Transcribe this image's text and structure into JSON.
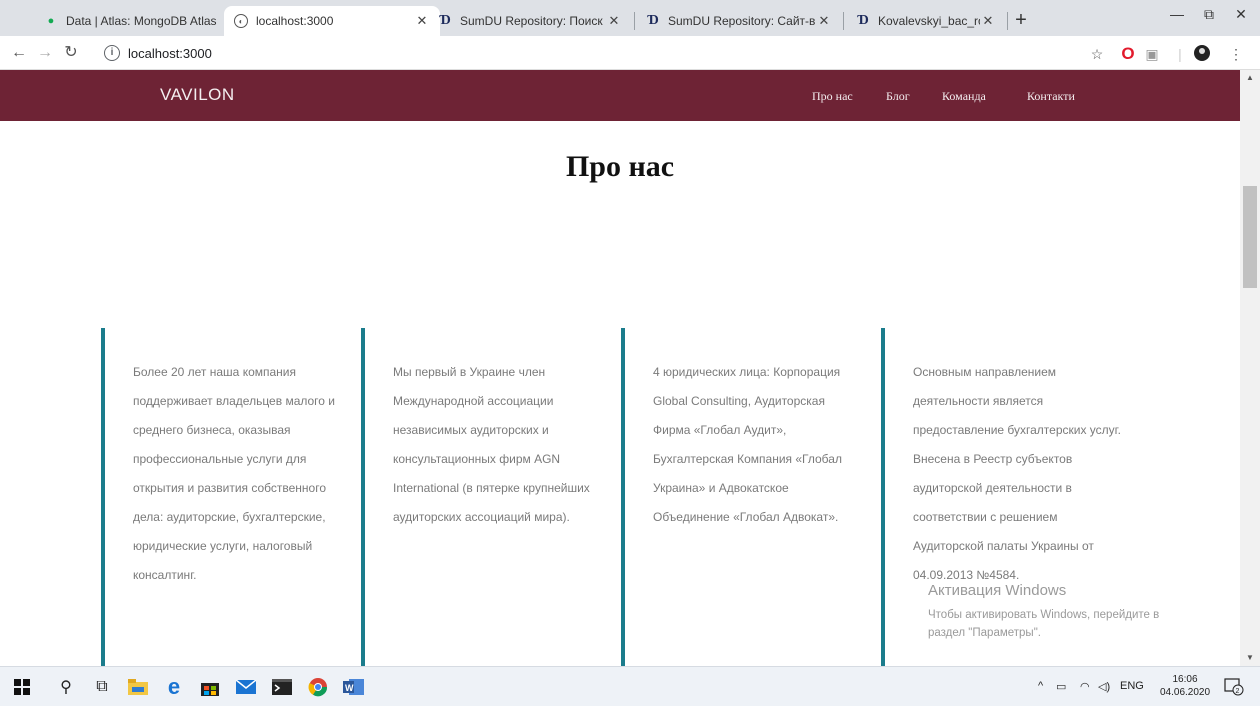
{
  "browser": {
    "tabs": [
      {
        "title": "Data | Atlas: MongoDB Atlas",
        "icon": "mongodb-leaf-icon"
      },
      {
        "title": "localhost:3000",
        "icon": "globe-icon",
        "active": true
      },
      {
        "title": "SumDU Repository: Поиск",
        "icon": "dspace-logo-icon"
      },
      {
        "title": "SumDU Repository: Сайт-візит",
        "icon": "dspace-logo-icon"
      },
      {
        "title": "Kovalevskyi_bac_rob.pdf",
        "icon": "dspace-logo-icon"
      }
    ],
    "address": "localhost:3000"
  },
  "site": {
    "brand": "VAVILON",
    "nav": [
      "Про нас",
      "Блог",
      "Команда",
      "Контакти"
    ],
    "nav_color": "#6e2335",
    "accent_color": "#1b7c8c",
    "page_title": "Про нас",
    "columns": [
      "Более 20 лет наша компания поддерживает владельцев малого и среднего бизнеса, оказывая профессиональные услуги для открытия и развития собственного дела: аудиторские, бухгалтерские, юридические услуги, налоговый консалтинг.",
      "Мы первый в Украине член Международной ассоциации независимых аудиторских и консультационных фирм AGN International (в пятерке крупнейших аудиторских ассоциаций мира).",
      "4 юридических лица: Корпорация Global Consulting, Аудиторская Фирма «Глобал Аудит», Бухгалтерская Компания «Глобал Украина» и Адвокатское Объединение «Глобал Адвокат».",
      "Основным направлением деятельности является предоставление бухгалтерских услуг. Внесена в Реестр субъектов аудиторской деятельности в соответствии с решением Аудиторской палаты Украины от 04.09.2013 №4584."
    ]
  },
  "watermark": {
    "title": "Активация Windows",
    "line1": "Чтобы активировать Windows, перейдите в",
    "line2": "раздел \"Параметры\"."
  },
  "taskbar": {
    "lang": "ENG",
    "time": "16:06",
    "date": "04.06.2020",
    "notification_count": "2"
  }
}
